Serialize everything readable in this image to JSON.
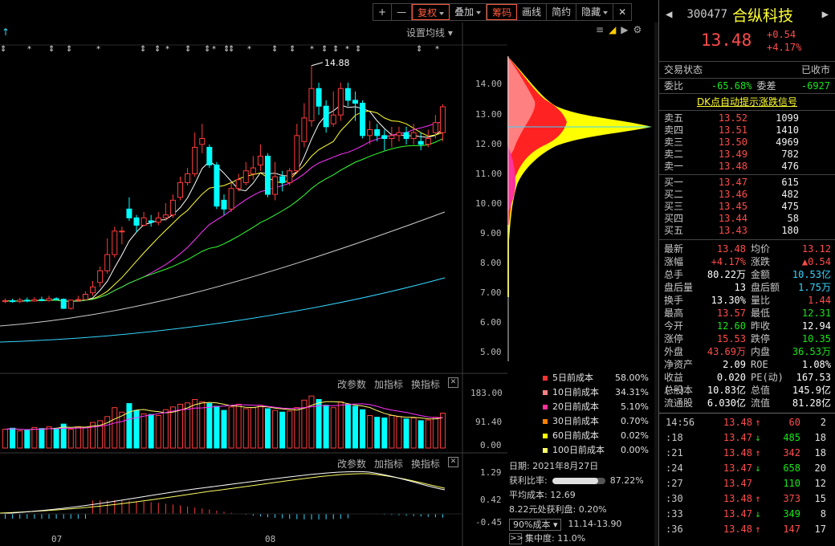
{
  "toolbar": {
    "plus": "+",
    "minus": "—",
    "items": [
      {
        "label": "复权",
        "dropdown": true,
        "selected": true
      },
      {
        "label": "叠加",
        "dropdown": true,
        "selected": false
      },
      {
        "label": "筹码",
        "dropdown": false,
        "selected": true
      },
      {
        "label": "画线",
        "dropdown": false,
        "selected": false
      },
      {
        "label": "简约",
        "dropdown": false,
        "selected": false
      },
      {
        "label": "隐藏",
        "dropdown": true,
        "selected": false
      }
    ],
    "close": "✕"
  },
  "kline": {
    "set_ma_label": "设置均线",
    "high_mark": "14.88",
    "price_ticks": [
      "14.00",
      "13.00",
      "12.00",
      "11.00",
      "10.00",
      "9.00",
      "8.00",
      "7.00",
      "6.00",
      "5.00"
    ],
    "vol_ticks": [
      "183.00",
      "91.40",
      "0.00"
    ],
    "macd_ticks": [
      "1.29",
      "0.42",
      "-0.45"
    ],
    "month_labels": [
      "07",
      "08"
    ],
    "panel_buttons": [
      "改参数",
      "加指标",
      "换指标"
    ],
    "close_icon": "✕"
  },
  "cost_legend": [
    {
      "label": "5日前成本",
      "value": "58.00%",
      "color": "#ff3333"
    },
    {
      "label": "10日前成本",
      "value": "34.31%",
      "color": "#ff8080"
    },
    {
      "label": "20日前成本",
      "value": "5.10%",
      "color": "#ff3399"
    },
    {
      "label": "30日前成本",
      "value": "0.70%",
      "color": "#ff8000"
    },
    {
      "label": "60日前成本",
      "value": "0.02%",
      "color": "#ffff00"
    },
    {
      "label": "100日前成本",
      "value": "0.00%",
      "color": "#ffff66"
    }
  ],
  "chip": {
    "date": "日期: 2021年8月27日",
    "profit_label": "获利比率:",
    "profit_value": "87.22%",
    "profit_fraction": 0.8722,
    "avg_cost": "平均成本: 12.69",
    "profit_at": "8.22元处获利盘: 0.20%",
    "cost_select": "90%成本",
    "cost_range": "11.14-13.90",
    "concentration": "集中度: 11.0%",
    "more": ">>"
  },
  "quote": {
    "code": "300477",
    "name": "合纵科技",
    "price": "13.48",
    "change": "+0.54",
    "change_pct": "+4.17%",
    "status_label": "交易状态",
    "status_value": "已收市",
    "weibi_label": "委比",
    "weibi_value": "-65.68%",
    "weicha_label": "委差",
    "weicha_value": "-6927",
    "signal_link": "DK点自动提示涨跌信号",
    "asks": [
      {
        "name": "卖五",
        "price": "13.52",
        "vol": "1099"
      },
      {
        "name": "卖四",
        "price": "13.51",
        "vol": "1410"
      },
      {
        "name": "卖三",
        "price": "13.50",
        "vol": "4969"
      },
      {
        "name": "卖二",
        "price": "13.49",
        "vol": "782"
      },
      {
        "name": "卖一",
        "price": "13.48",
        "vol": "476"
      }
    ],
    "bids": [
      {
        "name": "买一",
        "price": "13.47",
        "vol": "615"
      },
      {
        "name": "买二",
        "price": "13.46",
        "vol": "482"
      },
      {
        "name": "买三",
        "price": "13.45",
        "vol": "475"
      },
      {
        "name": "买四",
        "price": "13.44",
        "vol": "58"
      },
      {
        "name": "买五",
        "price": "13.43",
        "vol": "180"
      }
    ],
    "stats": [
      {
        "k1": "最新",
        "v1": "13.48",
        "c1": "red",
        "k2": "均价",
        "v2": "13.12",
        "c2": "red"
      },
      {
        "k1": "涨幅",
        "v1": "+4.17%",
        "c1": "red",
        "k2": "涨跌",
        "v2": "▲0.54",
        "c2": "red"
      },
      {
        "k1": "总手",
        "v1": "80.22万",
        "c1": "wht",
        "k2": "金额",
        "v2": "10.53亿",
        "c2": "cyn"
      },
      {
        "k1": "盘后量",
        "v1": "13",
        "c1": "wht",
        "k2": "盘后额",
        "v2": "1.75万",
        "c2": "cyn"
      },
      {
        "k1": "换手",
        "v1": "13.30%",
        "c1": "wht",
        "k2": "量比",
        "v2": "1.44",
        "c2": "red"
      },
      {
        "k1": "最高",
        "v1": "13.57",
        "c1": "red",
        "k2": "最低",
        "v2": "12.31",
        "c2": "grn"
      },
      {
        "k1": "今开",
        "v1": "12.60",
        "c1": "grn",
        "k2": "昨收",
        "v2": "12.94",
        "c2": "wht"
      },
      {
        "k1": "涨停",
        "v1": "15.53",
        "c1": "red",
        "k2": "跌停",
        "v2": "10.35",
        "c2": "grn"
      },
      {
        "k1": "外盘",
        "v1": "43.69万",
        "c1": "red",
        "k2": "内盘",
        "v2": "36.53万",
        "c2": "grn"
      },
      {
        "k1": "净资产",
        "v1": "2.09",
        "c1": "wht",
        "k2": "ROE",
        "v2": "1.08%",
        "c2": "wht"
      },
      {
        "k1": "收益(一)",
        "v1": "0.020",
        "c1": "wht",
        "k2": "PE(动)",
        "v2": "167.53",
        "c2": "wht"
      },
      {
        "k1": "总股本",
        "v1": "10.83亿",
        "c1": "wht",
        "k2": "总值",
        "v2": "145.9亿",
        "c2": "wht"
      },
      {
        "k1": "流通股",
        "v1": "6.030亿",
        "c1": "wht",
        "k2": "流值",
        "v2": "81.28亿",
        "c2": "wht"
      }
    ],
    "ticks": [
      {
        "t": "14:56",
        "p": "13.48",
        "pc": "red",
        "ar": "↑",
        "ac": "red",
        "v": "60",
        "vc": "red",
        "n": "2"
      },
      {
        "t": ":18",
        "p": "13.47",
        "pc": "red",
        "ar": "↓",
        "ac": "grn",
        "v": "485",
        "vc": "grn",
        "n": "18"
      },
      {
        "t": ":21",
        "p": "13.48",
        "pc": "red",
        "ar": "↑",
        "ac": "red",
        "v": "342",
        "vc": "red",
        "n": "18"
      },
      {
        "t": ":24",
        "p": "13.47",
        "pc": "red",
        "ar": "↓",
        "ac": "grn",
        "v": "658",
        "vc": "grn",
        "n": "20"
      },
      {
        "t": ":27",
        "p": "13.47",
        "pc": "red",
        "ar": "",
        "ac": "red",
        "v": "110",
        "vc": "grn",
        "n": "12"
      },
      {
        "t": ":30",
        "p": "13.48",
        "pc": "red",
        "ar": "↑",
        "ac": "red",
        "v": "373",
        "vc": "red",
        "n": "15"
      },
      {
        "t": ":33",
        "p": "13.47",
        "pc": "red",
        "ar": "↓",
        "ac": "grn",
        "v": "349",
        "vc": "grn",
        "n": "8"
      },
      {
        "t": ":36",
        "p": "13.48",
        "pc": "red",
        "ar": "↑",
        "ac": "red",
        "v": "147",
        "vc": "red",
        "n": "17"
      }
    ]
  },
  "chart_data": {
    "type": "candlestick",
    "ylim": [
      4.6,
      15.2
    ],
    "candles": [
      {
        "o": 6.86,
        "c": 6.88,
        "h": 6.96,
        "l": 6.8
      },
      {
        "o": 6.88,
        "c": 6.85,
        "h": 6.95,
        "l": 6.82
      },
      {
        "o": 6.85,
        "c": 6.9,
        "h": 6.98,
        "l": 6.8
      },
      {
        "o": 6.9,
        "c": 6.87,
        "h": 6.99,
        "l": 6.83
      },
      {
        "o": 6.87,
        "c": 6.92,
        "h": 7.0,
        "l": 6.85
      },
      {
        "o": 6.92,
        "c": 6.89,
        "h": 7.02,
        "l": 6.86
      },
      {
        "o": 6.89,
        "c": 6.95,
        "h": 7.05,
        "l": 6.85
      },
      {
        "o": 6.95,
        "c": 6.93,
        "h": 7.0,
        "l": 6.9
      },
      {
        "o": 6.93,
        "c": 6.62,
        "h": 6.96,
        "l": 6.6
      },
      {
        "o": 6.62,
        "c": 6.9,
        "h": 6.92,
        "l": 6.58
      },
      {
        "o": 6.9,
        "c": 6.92,
        "h": 7.05,
        "l": 6.85
      },
      {
        "o": 6.92,
        "c": 7.1,
        "h": 7.2,
        "l": 6.88
      },
      {
        "o": 7.15,
        "c": 7.35,
        "h": 7.55,
        "l": 7.05
      },
      {
        "o": 7.5,
        "c": 7.9,
        "h": 8.05,
        "l": 7.35
      },
      {
        "o": 7.9,
        "c": 8.45,
        "h": 9.0,
        "l": 7.8
      },
      {
        "o": 8.45,
        "c": 9.25,
        "h": 9.4,
        "l": 8.35
      },
      {
        "o": 9.25,
        "c": 9.25,
        "h": 9.4,
        "l": 8.8
      },
      {
        "o": 10.0,
        "c": 9.7,
        "h": 10.4,
        "l": 9.6
      },
      {
        "o": 9.7,
        "c": 9.45,
        "h": 9.8,
        "l": 9.2
      },
      {
        "o": 9.45,
        "c": 9.7,
        "h": 9.9,
        "l": 9.4
      },
      {
        "o": 9.6,
        "c": 9.55,
        "h": 9.8,
        "l": 9.4
      },
      {
        "o": 9.55,
        "c": 9.7,
        "h": 9.9,
        "l": 9.45
      },
      {
        "o": 9.7,
        "c": 9.8,
        "h": 10.2,
        "l": 9.6
      },
      {
        "o": 9.8,
        "c": 10.3,
        "h": 10.5,
        "l": 9.7
      },
      {
        "o": 10.4,
        "c": 10.9,
        "h": 11.1,
        "l": 10.3
      },
      {
        "o": 10.9,
        "c": 11.2,
        "h": 11.4,
        "l": 10.8
      },
      {
        "o": 11.2,
        "c": 12.1,
        "h": 12.6,
        "l": 11.1
      },
      {
        "o": 12.2,
        "c": 12.4,
        "h": 12.9,
        "l": 11.9
      },
      {
        "o": 12.1,
        "c": 11.5,
        "h": 12.2,
        "l": 11.4
      },
      {
        "o": 11.5,
        "c": 10.1,
        "h": 11.6,
        "l": 10.0
      },
      {
        "o": 10.3,
        "c": 10.0,
        "h": 10.5,
        "l": 9.8
      },
      {
        "o": 10.0,
        "c": 10.7,
        "h": 10.9,
        "l": 9.9
      },
      {
        "o": 10.7,
        "c": 11.0,
        "h": 11.2,
        "l": 10.6
      },
      {
        "o": 10.9,
        "c": 11.3,
        "h": 11.6,
        "l": 10.8
      },
      {
        "o": 11.2,
        "c": 11.4,
        "h": 11.8,
        "l": 11.0
      },
      {
        "o": 11.5,
        "c": 11.8,
        "h": 12.2,
        "l": 11.3
      },
      {
        "o": 11.8,
        "c": 10.5,
        "h": 11.9,
        "l": 10.4
      },
      {
        "o": 10.5,
        "c": 11.1,
        "h": 11.6,
        "l": 10.3
      },
      {
        "o": 11.1,
        "c": 10.9,
        "h": 11.3,
        "l": 10.6
      },
      {
        "o": 10.9,
        "c": 11.3,
        "h": 11.4,
        "l": 10.8
      },
      {
        "o": 11.3,
        "c": 12.5,
        "h": 12.9,
        "l": 11.2
      },
      {
        "o": 12.3,
        "c": 13.1,
        "h": 13.6,
        "l": 12.1
      },
      {
        "o": 13.0,
        "c": 14.1,
        "h": 14.88,
        "l": 12.8
      },
      {
        "o": 14.1,
        "c": 13.5,
        "h": 14.3,
        "l": 13.2
      },
      {
        "o": 13.5,
        "c": 12.8,
        "h": 13.7,
        "l": 12.6
      },
      {
        "o": 12.9,
        "c": 13.2,
        "h": 14.0,
        "l": 12.8
      },
      {
        "o": 13.2,
        "c": 14.1,
        "h": 14.3,
        "l": 13.0
      },
      {
        "o": 14.1,
        "c": 13.7,
        "h": 14.3,
        "l": 13.5
      },
      {
        "o": 13.7,
        "c": 13.6,
        "h": 14.0,
        "l": 13.0
      },
      {
        "o": 13.6,
        "c": 12.5,
        "h": 13.7,
        "l": 12.4
      },
      {
        "o": 12.5,
        "c": 12.7,
        "h": 13.0,
        "l": 12.2
      },
      {
        "o": 12.7,
        "c": 12.5,
        "h": 12.9,
        "l": 12.3
      },
      {
        "o": 12.5,
        "c": 12.4,
        "h": 12.7,
        "l": 12.0
      },
      {
        "o": 12.4,
        "c": 12.5,
        "h": 12.8,
        "l": 12.1
      },
      {
        "o": 12.5,
        "c": 12.6,
        "h": 12.8,
        "l": 12.3
      },
      {
        "o": 12.6,
        "c": 12.4,
        "h": 12.8,
        "l": 12.2
      },
      {
        "o": 12.4,
        "c": 12.6,
        "h": 12.9,
        "l": 12.2
      },
      {
        "o": 12.3,
        "c": 12.2,
        "h": 12.6,
        "l": 12.0
      },
      {
        "o": 12.2,
        "c": 12.4,
        "h": 12.7,
        "l": 12.1
      },
      {
        "o": 12.6,
        "c": 12.94,
        "h": 13.2,
        "l": 12.4
      },
      {
        "o": 12.6,
        "c": 13.48,
        "h": 13.57,
        "l": 12.31
      }
    ],
    "volumes": [
      55,
      58,
      50,
      52,
      60,
      57,
      62,
      58,
      70,
      55,
      62,
      60,
      75,
      80,
      92,
      118,
      105,
      130,
      110,
      100,
      98,
      95,
      112,
      120,
      128,
      132,
      142,
      135,
      130,
      122,
      110,
      120,
      128,
      115,
      118,
      125,
      115,
      110,
      105,
      108,
      118,
      140,
      152,
      142,
      125,
      118,
      135,
      128,
      122,
      112,
      95,
      90,
      88,
      95,
      92,
      85,
      88,
      80,
      82,
      90,
      102
    ],
    "vol_ylim": [
      0,
      183
    ],
    "profit_fraction": 0.8722,
    "month_labels": [
      "07",
      "08"
    ]
  }
}
